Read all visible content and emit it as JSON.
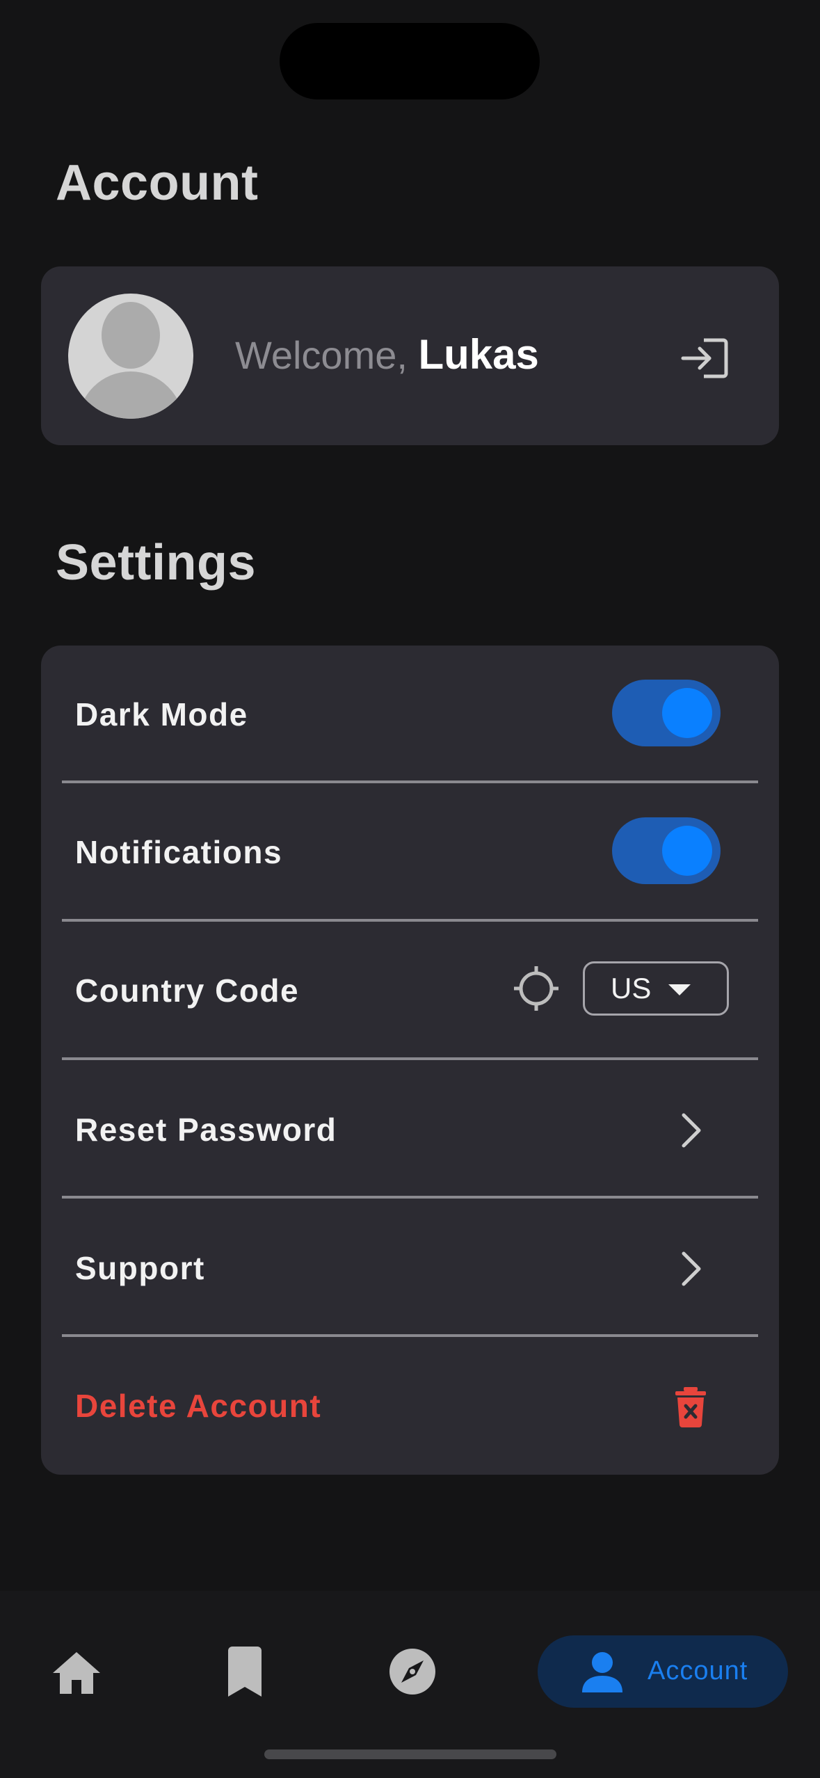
{
  "account": {
    "title": "Account",
    "welcome_prefix": "Welcome,",
    "user_name": "Lukas",
    "login_icon": "login-icon"
  },
  "settings": {
    "title": "Settings",
    "dark_mode": {
      "label": "Dark Mode",
      "enabled": true
    },
    "notifications": {
      "label": "Notifications",
      "enabled": true
    },
    "country_code": {
      "label": "Country Code",
      "value": "US"
    },
    "reset_password": {
      "label": "Reset Password"
    },
    "support": {
      "label": "Support"
    },
    "delete_account": {
      "label": "Delete Account"
    }
  },
  "nav": {
    "items": [
      {
        "icon": "home-icon"
      },
      {
        "icon": "bookmark-icon"
      },
      {
        "icon": "compass-icon"
      },
      {
        "icon": "person-icon",
        "label": "Account",
        "active": true
      }
    ]
  },
  "colors": {
    "background": "#141415",
    "card": "#2c2b32",
    "accent": "#0a80ff",
    "toggle_track": "#1e5db4",
    "danger": "#e8453c"
  }
}
